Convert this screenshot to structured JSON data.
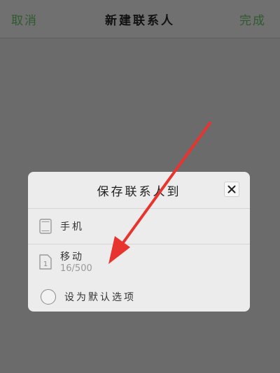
{
  "navbar": {
    "cancel_label": "取消",
    "title": "新建联系人",
    "done_label": "完成"
  },
  "dialog": {
    "title": "保存联系人到",
    "close_icon": "close-icon",
    "options": [
      {
        "label": "手机",
        "icon": "phone-icon"
      },
      {
        "label": "移动",
        "sub": "16/500",
        "icon": "sim-card-icon",
        "icon_text": "1"
      },
      {
        "label": "设为默认选项",
        "icon": "radio-unchecked"
      }
    ]
  },
  "colors": {
    "overlay": "#6b6b6b",
    "accent_green": "#2f5a2f",
    "annotation_arrow": "#e8342f"
  }
}
